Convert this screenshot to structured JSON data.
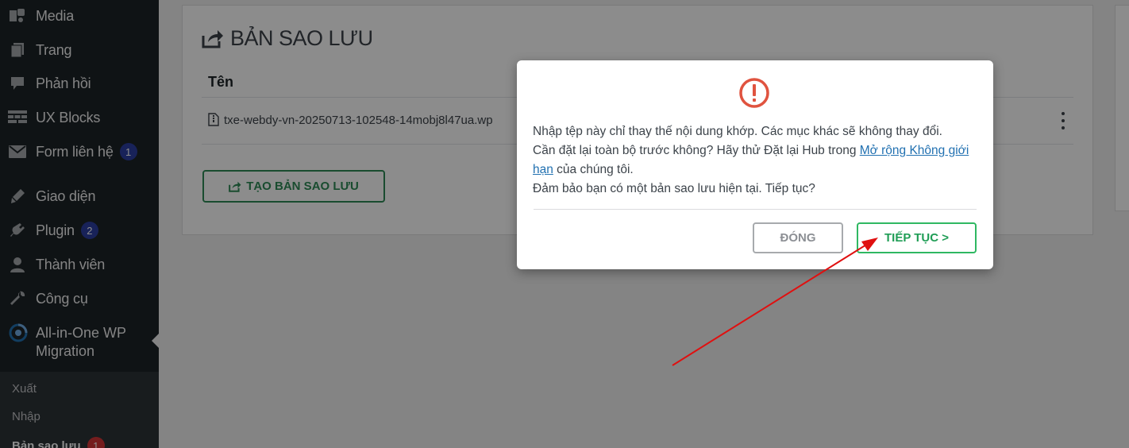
{
  "sidebar": {
    "items": [
      {
        "label": "Media",
        "icon": "media-icon"
      },
      {
        "label": "Trang",
        "icon": "page-icon"
      },
      {
        "label": "Phản hồi",
        "icon": "comment-icon"
      },
      {
        "label": "UX Blocks",
        "icon": "ux-blocks-icon"
      },
      {
        "label": "Form liên hệ",
        "icon": "mail-icon",
        "badge": "1"
      },
      {
        "label": "Giao diện",
        "icon": "appearance-icon"
      },
      {
        "label": "Plugin",
        "icon": "plugin-icon",
        "badge": "2"
      },
      {
        "label": "Thành viên",
        "icon": "user-icon"
      },
      {
        "label": "Công cụ",
        "icon": "wrench-icon"
      }
    ],
    "current": {
      "label": "All-in-One WP Migration",
      "icon": "migration-icon"
    },
    "submenu": [
      {
        "label": "Xuất"
      },
      {
        "label": "Nhập"
      },
      {
        "label": "Bản sao lưu",
        "badge": "1"
      }
    ]
  },
  "panel": {
    "title": "BẢN SAO LƯU",
    "column_name": "Tên",
    "file_name": "txe-webdy-vn-20250713-102548-14mobj8l47ua.wp",
    "create_button": "TẠO BẢN SAO LƯU"
  },
  "modal": {
    "line1": "Nhập tệp này chỉ thay thế nội dung khớp. Các mục khác sẽ không thay đổi.",
    "line2_prefix": "Cần đặt lại toàn bộ trước không? Hãy thử Đặt lại Hub trong ",
    "line2_link": "Mở rộng Không giới hạn",
    "line2_suffix": " của chúng tôi.",
    "line3": "Đảm bảo bạn có một bản sao lưu hiện tại. Tiếp tục?",
    "close_button": "ĐÓNG",
    "continue_button": "TIẾP TỤC >"
  },
  "colors": {
    "sidebar_bg": "#1d2327",
    "accent_green": "#2fb862",
    "warning_red": "#e0533f",
    "annotation_red": "#e01010",
    "badge_blue": "#2c3fa3",
    "badge_red": "#d63638"
  }
}
